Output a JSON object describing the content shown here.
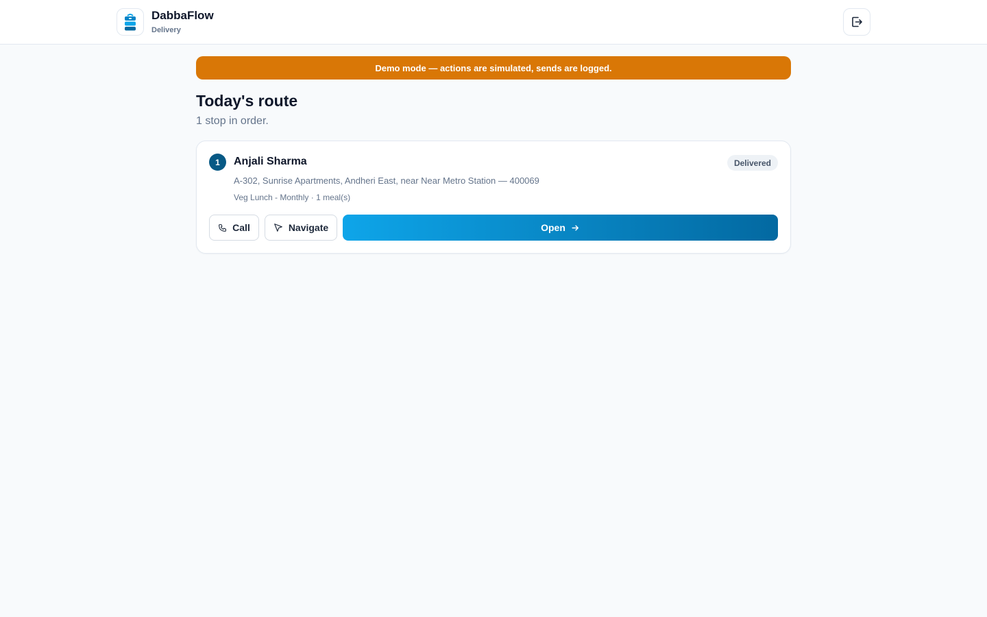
{
  "app": {
    "name": "DabbaFlow",
    "role": "Delivery",
    "logo_icon": "tiffin-box-icon",
    "logout_icon": "logout-icon"
  },
  "banner": {
    "text": "Demo mode — actions are simulated, sends are logged.",
    "color": "#d97706"
  },
  "page": {
    "title": "Today's route",
    "subtitle": "1 stop in order."
  },
  "stops": [
    {
      "sequence": "1",
      "customer_name": "Anjali Sharma",
      "status": "Delivered",
      "address": "A-302, Sunrise Apartments, Andheri East, near Near Metro Station — 400069",
      "meta": "Veg Lunch - Monthly · 1 meal(s)",
      "actions": {
        "call_label": "Call",
        "navigate_label": "Navigate",
        "open_label": "Open"
      }
    }
  ],
  "colors": {
    "accent_start": "#0ea5e9",
    "accent_end": "#0369a1",
    "badge_bg": "#eef2f6"
  }
}
